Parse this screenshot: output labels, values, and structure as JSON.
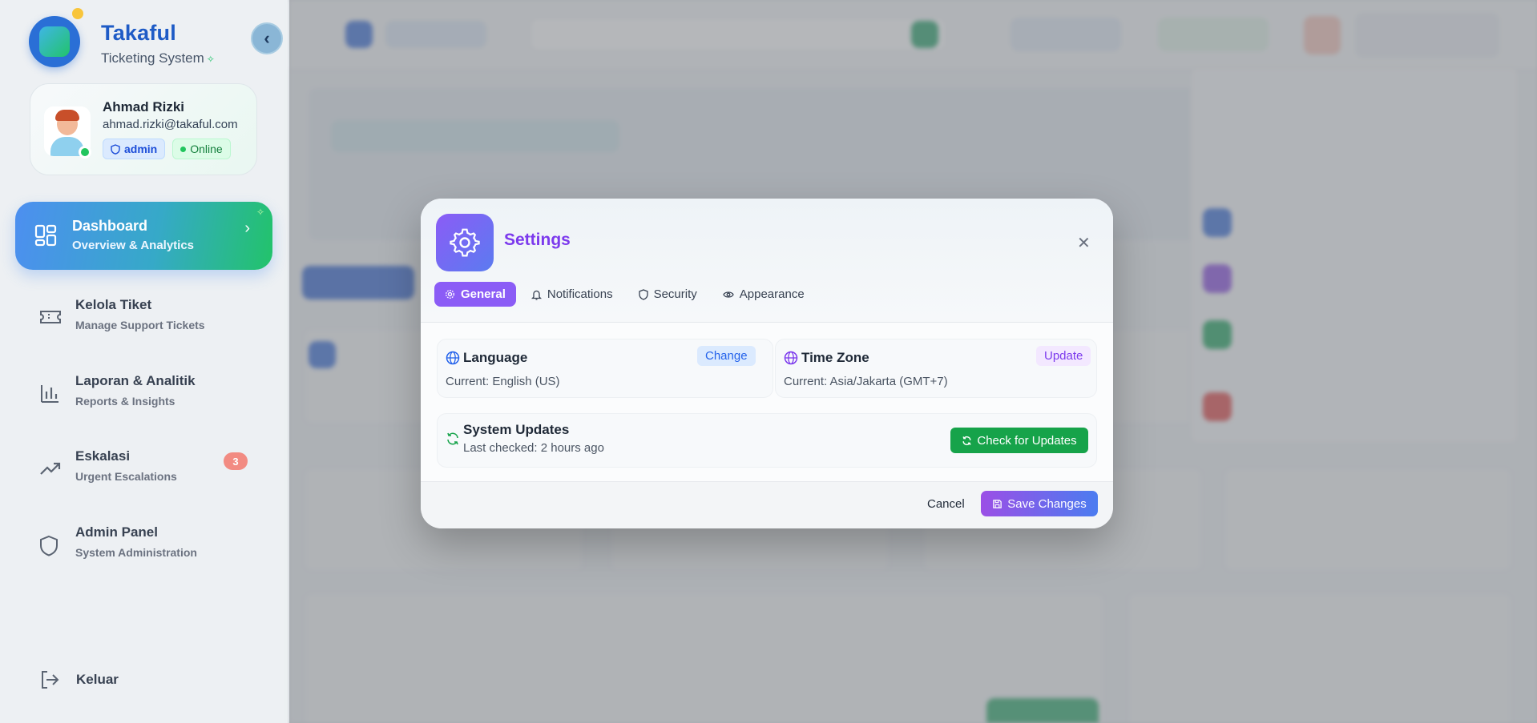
{
  "sidebar": {
    "brand_title": "Takaful",
    "brand_subtitle": "Ticketing System",
    "user": {
      "name": "Ahmad Rizki",
      "email": "ahmad.rizki@takaful.com",
      "role": "admin",
      "status": "Online"
    },
    "nav": [
      {
        "label": "Dashboard",
        "sub": "Overview & Analytics",
        "icon": "dashboard-grid-icon",
        "active": true
      },
      {
        "label": "Kelola Tiket",
        "sub": "Manage Support Tickets",
        "icon": "ticket-icon"
      },
      {
        "label": "Laporan & Analitik",
        "sub": "Reports & Insights",
        "icon": "bar-chart-icon"
      },
      {
        "label": "Eskalasi",
        "sub": "Urgent Escalations",
        "icon": "trending-up-icon",
        "badge": "3"
      },
      {
        "label": "Admin Panel",
        "sub": "System Administration",
        "icon": "shield-icon"
      }
    ],
    "logout_label": "Keluar"
  },
  "settings_modal": {
    "title": "Settings",
    "tabs": [
      {
        "label": "General",
        "icon": "gear-icon",
        "active": true
      },
      {
        "label": "Notifications",
        "icon": "bell-icon"
      },
      {
        "label": "Security",
        "icon": "shield-icon"
      },
      {
        "label": "Appearance",
        "icon": "eye-icon"
      }
    ],
    "language": {
      "title": "Language",
      "value": "Current: English (US)",
      "action": "Change"
    },
    "timezone": {
      "title": "Time Zone",
      "value": "Current: Asia/Jakarta (GMT+7)",
      "action": "Update"
    },
    "updates": {
      "title": "System Updates",
      "value": "Last checked: 2 hours ago",
      "action": "Check for Updates"
    },
    "cancel_label": "Cancel",
    "save_label": "Save Changes"
  },
  "colors": {
    "brand_blue": "#1e5bc6",
    "accent_purple": "#8b5cf6",
    "success_green": "#16a34a",
    "badge_red": "#f28b82"
  }
}
